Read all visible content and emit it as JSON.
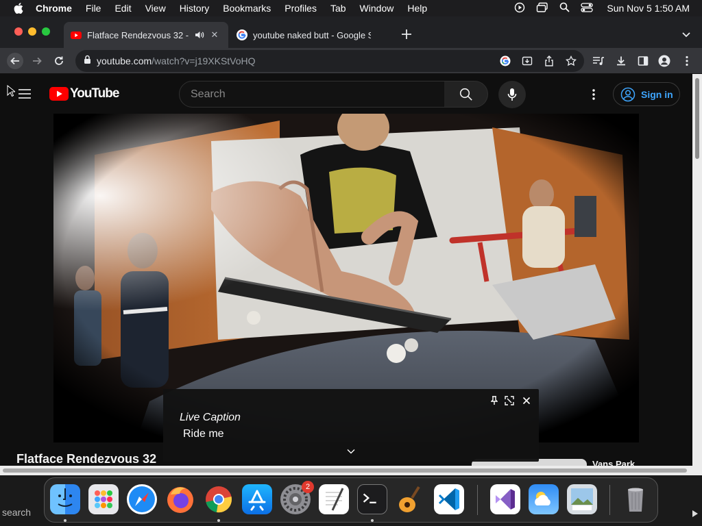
{
  "menubar": {
    "app": "Chrome",
    "items": [
      "File",
      "Edit",
      "View",
      "History",
      "Bookmarks",
      "Profiles",
      "Tab",
      "Window",
      "Help"
    ],
    "clock": "Sun Nov 5  1:50 AM"
  },
  "tabs": [
    {
      "title": "Flatface Rendezvous 32 -",
      "active": true,
      "icon": "youtube-favicon"
    },
    {
      "title": "youtube naked butt - Google S",
      "active": false,
      "icon": "google-favicon"
    }
  ],
  "omnibox": {
    "host": "youtube.com",
    "path": "/watch?v=j19XKStVoHQ"
  },
  "youtube": {
    "logo_text": "YouTube",
    "search_placeholder": "Search",
    "signin_label": "Sign in",
    "video_title": "Flatface Rendezvous 32",
    "related_title": "Vans Park"
  },
  "live_caption": {
    "heading": "Live Caption",
    "text": "Ride me"
  },
  "dock": {
    "left_label": "search",
    "settings_badge": "2",
    "apps": [
      "finder",
      "launchpad",
      "safari",
      "firefox",
      "chrome",
      "app-store",
      "system-settings",
      "textedit",
      "terminal",
      "garageband",
      "vscode",
      "visual-studio",
      "weather",
      "preview",
      "trash"
    ]
  },
  "colors": {
    "youtube_red": "#ff0000",
    "link_blue": "#3ea6ff"
  }
}
